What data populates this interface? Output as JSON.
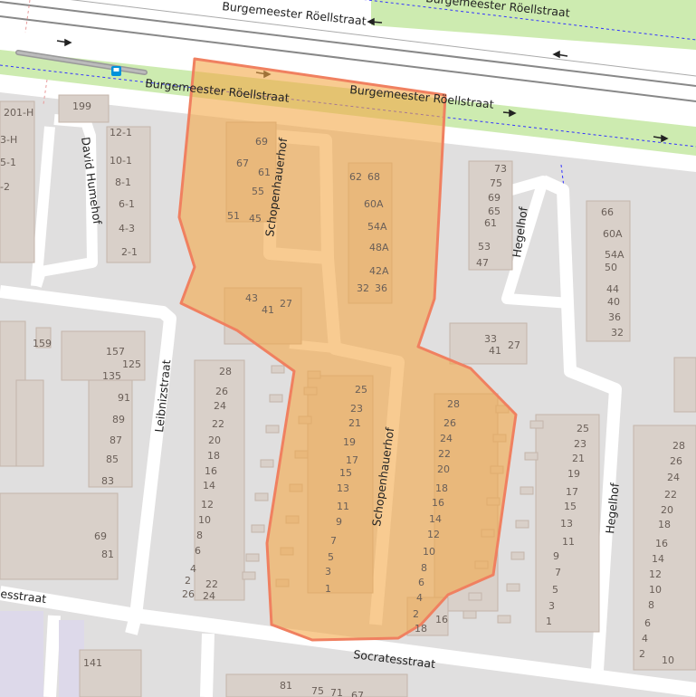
{
  "colors": {
    "background": "#e0dfdf",
    "road": "#ffffff",
    "building": "#d9d0c9",
    "building_outline": "#c4b5aa",
    "park_strip": "#cdebb0",
    "highlight_fill": "#f4a847",
    "highlight_outline": "#f08060",
    "boundary_dashed": "#3333ff",
    "rail": "#999999"
  },
  "icons": [
    "bus-stop-icon",
    "one-way-arrow-icon"
  ],
  "streets": {
    "roellstraat_top": "Burgemeester Röellstraat",
    "roellstraat_mid_left": "Burgemeester Röellstraat",
    "roellstraat_mid_right": "Burgemeester Röellstraat",
    "roellstraat_far_right": "Burgemeester Röellstraat",
    "david_humehof": "David Humehof",
    "schopenhauerhof_north": "Schopenhauerhof",
    "schopenhauerhof_south": "Schopenhauerhof",
    "hegelhof_north": "Hegelhof",
    "hegelhof_south": "Hegelhof",
    "leibnizstraat": "Leibnizstraat",
    "socratesstraat": "Socratesstraat",
    "socratesstraat_west": "esstraat"
  },
  "house_numbers": {
    "west_block": [
      "201-H",
      "3-H",
      "5-1",
      "-2",
      "199",
      "12-1",
      "10-1",
      "8-1",
      "6-1",
      "4-3",
      "2-1"
    ],
    "schop_north": [
      "69",
      "67",
      "61",
      "55",
      "51",
      "45",
      "62",
      "68",
      "60A",
      "54A",
      "48A",
      "42A",
      "32",
      "36",
      "43",
      "41",
      "27"
    ],
    "hegelhof_north": [
      "73",
      "75",
      "69",
      "65",
      "61",
      "53",
      "47",
      "33",
      "41",
      "27",
      "66",
      "60A",
      "54A",
      "50",
      "44",
      "40",
      "36",
      "32"
    ],
    "leibniz_block": [
      "159",
      "157",
      "125",
      "135",
      "91",
      "89",
      "87",
      "85",
      "83",
      "69",
      "81"
    ],
    "leibniz_east": [
      "28",
      "26",
      "24",
      "22",
      "20",
      "18",
      "16",
      "14",
      "12",
      "10",
      "8",
      "6",
      "4",
      "2",
      "22",
      "26",
      "24"
    ],
    "schop_south_west": [
      "25",
      "23",
      "21",
      "19",
      "17",
      "15",
      "13",
      "11",
      "9",
      "7",
      "5",
      "3",
      "1"
    ],
    "schop_south_east": [
      "28",
      "26",
      "24",
      "22",
      "20",
      "18",
      "16",
      "14",
      "12",
      "10",
      "8",
      "6",
      "4",
      "2",
      "18",
      "16"
    ],
    "hegelhof_south_west": [
      "25",
      "23",
      "21",
      "19",
      "17",
      "15",
      "13",
      "11",
      "9",
      "7",
      "5",
      "3",
      "1"
    ],
    "hegelhof_south_east": [
      "28",
      "26",
      "24",
      "22",
      "20",
      "18",
      "16",
      "14",
      "12",
      "10",
      "8",
      "6",
      "4",
      "2",
      "10"
    ],
    "socrates_south": [
      "141",
      "81",
      "75",
      "71",
      "67"
    ]
  }
}
